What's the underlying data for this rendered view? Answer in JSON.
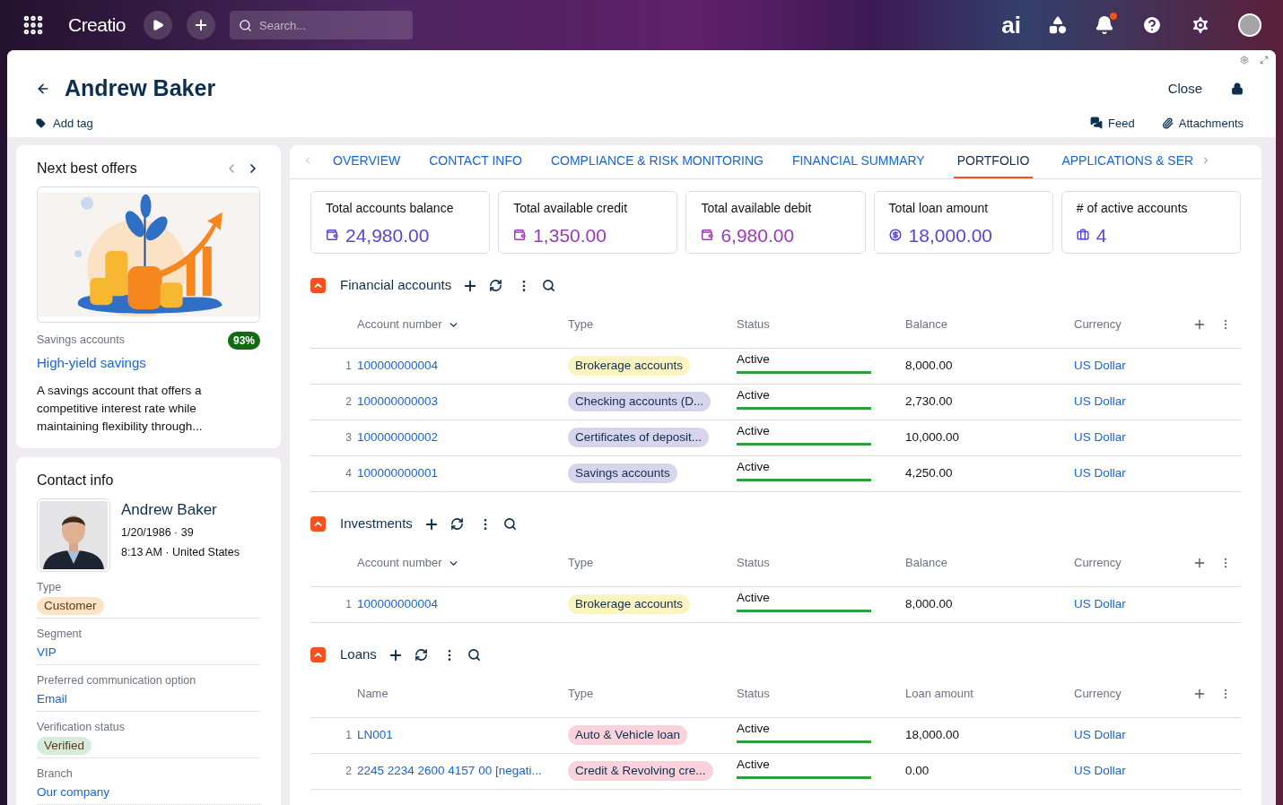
{
  "topbar": {
    "logo": "Creatio",
    "search": {
      "placeholder": "Search..."
    },
    "ai_label": "ai",
    "notifications_unread": true
  },
  "header": {
    "title": "Andrew Baker",
    "add_tag": "Add tag",
    "close": "Close",
    "feed": "Feed",
    "attachments": "Attachments"
  },
  "offers": {
    "title": "Next best offers",
    "category": "Savings accounts",
    "score": "93%",
    "name": "High-yield savings",
    "description": "A savings account that offers a competitive interest rate while maintaining flexibility through..."
  },
  "contact": {
    "title": "Contact info",
    "name": "Andrew Baker",
    "birth": "1/20/1986 · 39",
    "local": "8:13 AM · United States",
    "fields": [
      {
        "label": "Type",
        "value": "Customer",
        "kind": "tag",
        "color": "#fde3c6"
      },
      {
        "label": "Segment",
        "value": "VIP",
        "kind": "link"
      },
      {
        "label": "Preferred communication option",
        "value": "Email",
        "kind": "link"
      },
      {
        "label": "Verification status",
        "value": "Verified",
        "kind": "tag",
        "color": "#d7ebda"
      },
      {
        "label": "Branch",
        "value": "Our company",
        "kind": "link"
      }
    ]
  },
  "tabs": [
    {
      "label": "OVERVIEW",
      "selected": false
    },
    {
      "label": "CONTACT INFO",
      "selected": false
    },
    {
      "label": "COMPLIANCE & RISK MONITORING",
      "selected": false
    },
    {
      "label": "FINANCIAL SUMMARY",
      "selected": false
    },
    {
      "label": "PORTFOLIO",
      "selected": true
    },
    {
      "label": "APPLICATIONS & SER",
      "selected": false
    }
  ],
  "metrics": [
    {
      "label": "Total accounts balance",
      "value": "24,980.00",
      "kind": "wallet",
      "color": "#5a45cf"
    },
    {
      "label": "Total available credit",
      "value": "1,350.00",
      "kind": "wallet",
      "color": "#9b3cb7"
    },
    {
      "label": "Total available debit",
      "value": "6,980.00",
      "kind": "wallet",
      "color": "#9b3cb7"
    },
    {
      "label": "Total loan amount",
      "value": "18,000.00",
      "kind": "coin",
      "color": "#5a45cf"
    },
    {
      "label": "# of active accounts",
      "value": "4",
      "kind": "briefcase",
      "color": "#5a45cf"
    }
  ],
  "sections": [
    {
      "title": "Financial accounts",
      "columns": [
        "Account number",
        "Type",
        "Status",
        "Balance",
        "Currency"
      ],
      "sortable": true,
      "rows": [
        {
          "index": "1",
          "number": "100000000004",
          "type": "Brokerage accounts",
          "color": "#fcf3c3",
          "status": "Active",
          "amount": "8,000.00",
          "currency": "US Dollar"
        },
        {
          "index": "2",
          "number": "100000000003",
          "type": "Checking accounts (D...",
          "color": "#d6d5ec",
          "status": "Active",
          "amount": "2,730.00",
          "currency": "US Dollar"
        },
        {
          "index": "3",
          "number": "100000000002",
          "type": "Certificates of deposit...",
          "color": "#d6d5ec",
          "status": "Active",
          "amount": "10,000.00",
          "currency": "US Dollar"
        },
        {
          "index": "4",
          "number": "100000000001",
          "type": "Savings accounts",
          "color": "#d6d5ec",
          "status": "Active",
          "amount": "4,250.00",
          "currency": "US Dollar"
        }
      ]
    },
    {
      "title": "Investments",
      "columns": [
        "Account number",
        "Type",
        "Status",
        "Balance",
        "Currency"
      ],
      "sortable": true,
      "rows": [
        {
          "index": "1",
          "number": "100000000004",
          "type": "Brokerage accounts",
          "color": "#fcf3c3",
          "status": "Active",
          "amount": "8,000.00",
          "currency": "US Dollar"
        }
      ]
    },
    {
      "title": "Loans",
      "columns": [
        "Name",
        "Type",
        "Status",
        "Loan amount",
        "Currency"
      ],
      "sortable": false,
      "rows": [
        {
          "index": "1",
          "number": "LN001",
          "type": "Auto & Vehicle loan",
          "color": "#f8d3dc",
          "status": "Active",
          "amount": "18,000.00",
          "currency": "US Dollar"
        },
        {
          "index": "2",
          "number": "2245 2234 2600 4157 00 [negati...",
          "type": "Credit & Revolving cre...",
          "color": "#f8d3dc",
          "status": "Active",
          "amount": "0.00",
          "currency": "US Dollar"
        }
      ]
    }
  ]
}
